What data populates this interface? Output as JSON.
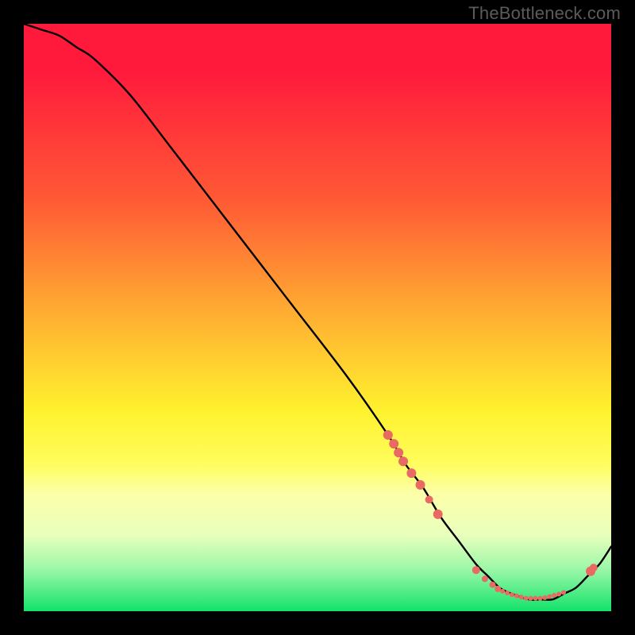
{
  "watermark": "TheBottleneck.com",
  "chart_data": {
    "type": "line",
    "title": "",
    "xlabel": "",
    "ylabel": "",
    "xlim": [
      0,
      100
    ],
    "ylim": [
      0,
      100
    ],
    "curve": {
      "x": [
        0,
        3,
        6,
        9,
        12,
        18,
        25,
        35,
        45,
        55,
        62,
        65,
        68,
        71,
        74,
        77,
        79,
        81,
        83,
        86,
        88,
        90,
        92,
        94,
        96,
        98,
        100
      ],
      "y": [
        100,
        99,
        98,
        96,
        94,
        88,
        79,
        66,
        53,
        40,
        30,
        25,
        21,
        16,
        12,
        8,
        6,
        4,
        3,
        2,
        2,
        2,
        3,
        4,
        6,
        8,
        11
      ]
    },
    "dots": {
      "color": "#e86a63",
      "points": [
        {
          "x": 62.0,
          "y": 30.0,
          "r": 6
        },
        {
          "x": 63.0,
          "y": 28.5,
          "r": 6
        },
        {
          "x": 63.8,
          "y": 27.0,
          "r": 6
        },
        {
          "x": 64.6,
          "y": 25.5,
          "r": 6
        },
        {
          "x": 66.0,
          "y": 23.5,
          "r": 6
        },
        {
          "x": 67.5,
          "y": 21.5,
          "r": 6
        },
        {
          "x": 69.0,
          "y": 19.0,
          "r": 5
        },
        {
          "x": 70.5,
          "y": 16.5,
          "r": 6
        },
        {
          "x": 77.0,
          "y": 7.0,
          "r": 5
        },
        {
          "x": 78.5,
          "y": 5.5,
          "r": 4
        },
        {
          "x": 79.8,
          "y": 4.5,
          "r": 4
        },
        {
          "x": 80.7,
          "y": 3.8,
          "r": 4
        },
        {
          "x": 81.5,
          "y": 3.4,
          "r": 3
        },
        {
          "x": 82.3,
          "y": 3.1,
          "r": 3
        },
        {
          "x": 83.1,
          "y": 2.8,
          "r": 3
        },
        {
          "x": 83.9,
          "y": 2.6,
          "r": 3
        },
        {
          "x": 84.7,
          "y": 2.4,
          "r": 3
        },
        {
          "x": 85.5,
          "y": 2.2,
          "r": 3
        },
        {
          "x": 86.3,
          "y": 2.2,
          "r": 3
        },
        {
          "x": 87.1,
          "y": 2.2,
          "r": 3
        },
        {
          "x": 87.9,
          "y": 2.2,
          "r": 3
        },
        {
          "x": 88.7,
          "y": 2.3,
          "r": 3
        },
        {
          "x": 89.5,
          "y": 2.5,
          "r": 3
        },
        {
          "x": 90.3,
          "y": 2.7,
          "r": 3
        },
        {
          "x": 91.1,
          "y": 2.9,
          "r": 3
        },
        {
          "x": 91.9,
          "y": 3.2,
          "r": 3
        },
        {
          "x": 96.5,
          "y": 6.8,
          "r": 6
        },
        {
          "x": 97.0,
          "y": 7.4,
          "r": 5
        }
      ]
    }
  }
}
